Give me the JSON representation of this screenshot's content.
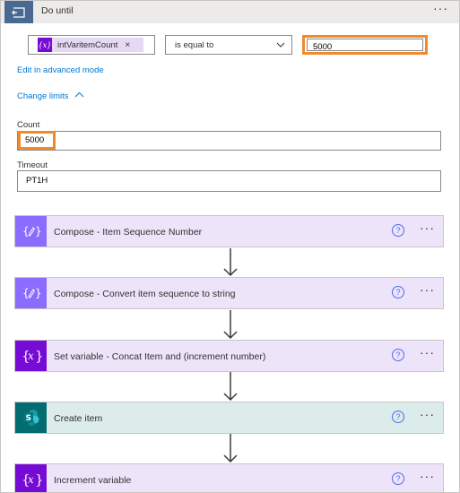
{
  "header": {
    "title": "Do until",
    "more_label": "···"
  },
  "condition": {
    "token": {
      "icon_glyph": "{x}",
      "label": "intVaritemCount",
      "remove_glyph": "×"
    },
    "operator": "is equal to",
    "value": "5000"
  },
  "links": {
    "advanced_mode": "Edit in advanced mode",
    "change_limits": "Change limits"
  },
  "limits": {
    "count_label": "Count",
    "count_value": "5000",
    "timeout_label": "Timeout",
    "timeout_value": "PT1H"
  },
  "actions": [
    {
      "title": "Compose - Item Sequence Number",
      "icon": "compose-icon",
      "color": "#8c6cff"
    },
    {
      "title": "Compose - Convert item sequence to string",
      "icon": "compose-icon",
      "color": "#8c6cff"
    },
    {
      "title": "Set variable - Concat Item and (increment number)",
      "icon": "variable-icon",
      "color": "#770bd6"
    },
    {
      "title": "Create item",
      "icon": "sharepoint-icon",
      "color": "#036c70"
    },
    {
      "title": "Increment variable",
      "icon": "variable-icon",
      "color": "#770bd6"
    }
  ],
  "help_glyph": "?",
  "more_glyph": "···",
  "colors": {
    "highlight": "#f08a2b",
    "link": "#0078d4",
    "loop_header_icon": "#486991"
  }
}
